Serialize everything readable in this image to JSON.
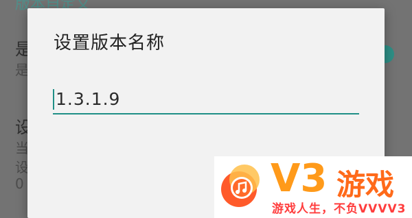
{
  "background": {
    "section_title": "版本自定义",
    "row1_title": "是",
    "row1_sub": "是",
    "row2_title": "设",
    "row2_sub1": "当",
    "row2_sub2": "设",
    "row2_sub3": "0"
  },
  "dialog": {
    "title": "设置版本名称",
    "input_value": "1.3.1.9"
  },
  "watermark": {
    "brand": "V3",
    "brand_suffix": "游戏",
    "slogan": "游戏人生，不负VVVV3"
  },
  "colors": {
    "accent": "#1f8f86",
    "watermark_orange": "#ff9a1a",
    "watermark_red": "#ff3d3d"
  }
}
